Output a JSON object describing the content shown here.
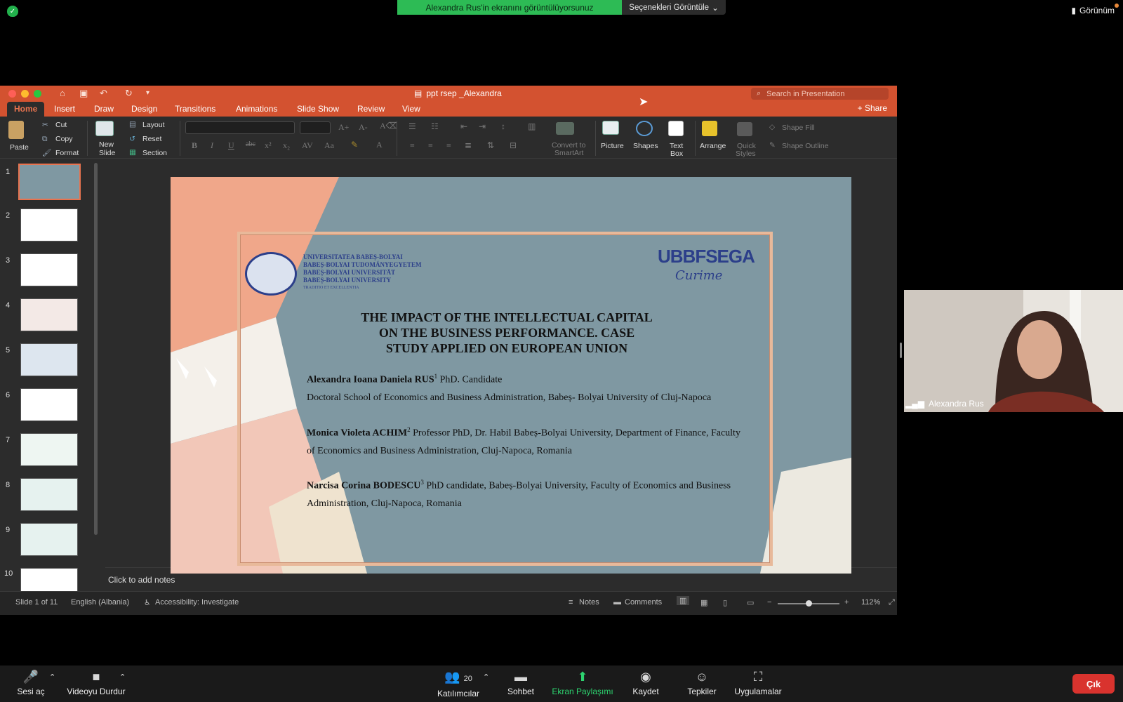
{
  "zoom": {
    "share_banner": "Alexandra Rus'in ekranını görüntülüyorsunuz",
    "options_label": "Seçenekleri Görüntüle",
    "view_label": "Görünüm",
    "participant_count": "20",
    "toolbar": {
      "mute": "Sesi aç",
      "video": "Videoyu Durdur",
      "participants": "Katılımcılar",
      "chat": "Sohbet",
      "share": "Ekran Paylaşımı",
      "record": "Kaydet",
      "reactions": "Tepkiler",
      "apps": "Uygulamalar",
      "exit": "Çık"
    },
    "webcam_name": "Alexandra Rus"
  },
  "ppt": {
    "doc_title": "ppt rsep _Alexandra",
    "search_placeholder": "Search in Presentation",
    "tabs": [
      "Home",
      "Insert",
      "Draw",
      "Design",
      "Transitions",
      "Animations",
      "Slide Show",
      "Review",
      "View"
    ],
    "share": "Share",
    "ribbon": {
      "paste": "Paste",
      "cut": "Cut",
      "copy": "Copy",
      "format": "Format",
      "new_slide_1": "New",
      "new_slide_2": "Slide",
      "layout": "Layout",
      "reset": "Reset",
      "section": "Section",
      "convert_1": "Convert to",
      "convert_2": "SmartArt",
      "picture": "Picture",
      "shapes": "Shapes",
      "textbox_1": "Text",
      "textbox_2": "Box",
      "arrange": "Arrange",
      "quick_1": "Quick",
      "quick_2": "Styles",
      "shape_fill": "Shape Fill",
      "shape_outline": "Shape Outline"
    },
    "thumbnails": [
      "1",
      "2",
      "3",
      "4",
      "5",
      "6",
      "7",
      "8",
      "9",
      "10"
    ],
    "slide": {
      "uni_lines": [
        "UNIVERSITATEA BABEȘ-BOLYAI",
        "BABEȘ-BOLYAI TUDOMÁNYEGYETEM",
        "BABEȘ-BOLYAI UNIVERSITÄT",
        "BABEȘ-BOLYAI UNIVERSITY"
      ],
      "uni_motto": "TRADITIO ET EXCELLENTIA",
      "fsega_logo": "UBBFSEGA",
      "fsega_sub": "Curime",
      "title_lines": [
        "THE IMPACT OF THE INTELLECTUAL CAPITAL",
        "ON THE BUSINESS PERFORMANCE. CASE",
        "STUDY APPLIED ON EUROPEAN UNION"
      ],
      "author1_name": "Alexandra Ioana Daniela RUS",
      "author1_sup": "1",
      "author1_role": " PhD. Candidate",
      "author1_line2": "Doctoral School of Economics and Business Administration, Babeș- Bolyai University of Cluj-Napoca",
      "author2_name": "Monica Violeta ACHIM",
      "author2_sup": "2",
      "author2_role": " Professor PhD, Dr. Habil Babeș-Bolyai University, Department of Finance, Faculty",
      "author2_line2": "of Economics and Business Administration, Cluj-Napoca, Romania",
      "author3_name": "Narcisa Corina BODESCU",
      "author3_sup": "3",
      "author3_role": " PhD candidate, Babeș-Bolyai University, Faculty of Economics and Business",
      "author3_line2": "Administration, Cluj-Napoca, Romania"
    },
    "notes_placeholder": "Click to add notes",
    "status": {
      "slide_of": "Slide 1 of 11",
      "language": "English (Albania)",
      "accessibility": "Accessibility: Investigate",
      "notes": "Notes",
      "comments": "Comments",
      "zoom": "112%"
    }
  }
}
